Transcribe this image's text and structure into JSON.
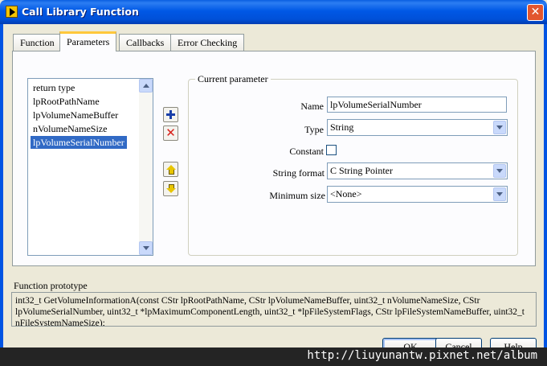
{
  "window": {
    "title": "Call Library Function",
    "close_glyph": "✕"
  },
  "tabs": [
    {
      "label": "Function"
    },
    {
      "label": "Parameters"
    },
    {
      "label": "Callbacks"
    },
    {
      "label": "Error Checking"
    }
  ],
  "active_tab": "Parameters",
  "parameter_list": {
    "items": [
      {
        "label": "return type"
      },
      {
        "label": "lpRootPathName"
      },
      {
        "label": "lpVolumeNameBuffer"
      },
      {
        "label": "nVolumeNameSize"
      },
      {
        "label": "lpVolumeSerialNumber"
      }
    ],
    "selected_index": 4
  },
  "side_buttons": {
    "add_icon": "plus-icon",
    "delete_icon": "x-icon",
    "delete_glyph": "✕",
    "move_up_icon": "arrow-up-icon",
    "move_down_icon": "arrow-down-icon"
  },
  "current_parameter": {
    "legend": "Current parameter",
    "name_label": "Name",
    "name_value": "lpVolumeSerialNumber",
    "type_label": "Type",
    "type_value": "String",
    "constant_label": "Constant",
    "constant_checked": false,
    "string_format_label": "String format",
    "string_format_value": "C String Pointer",
    "minimum_size_label": "Minimum size",
    "minimum_size_value": "<None>"
  },
  "prototype": {
    "label": "Function prototype",
    "text": "int32_t GetVolumeInformationA(const CStr lpRootPathName, CStr lpVolumeNameBuffer, uint32_t nVolumeNameSize, CStr lpVolumeSerialNumber, uint32_t *lpMaximumComponentLength, uint32_t *lpFileSystemFlags, CStr lpFileSystemNameBuffer, uint32_t nFileSystemNameSize);"
  },
  "buttons": {
    "ok": "OK",
    "cancel": "Cancel",
    "help": "Help"
  },
  "watermark": "http://liuyunantw.pixnet.net/album",
  "colors": {
    "titlebar": "#0058e6",
    "selection": "#316ac5",
    "dialog_face": "#ece9d8",
    "active_tab_accent": "#ffc83c"
  }
}
